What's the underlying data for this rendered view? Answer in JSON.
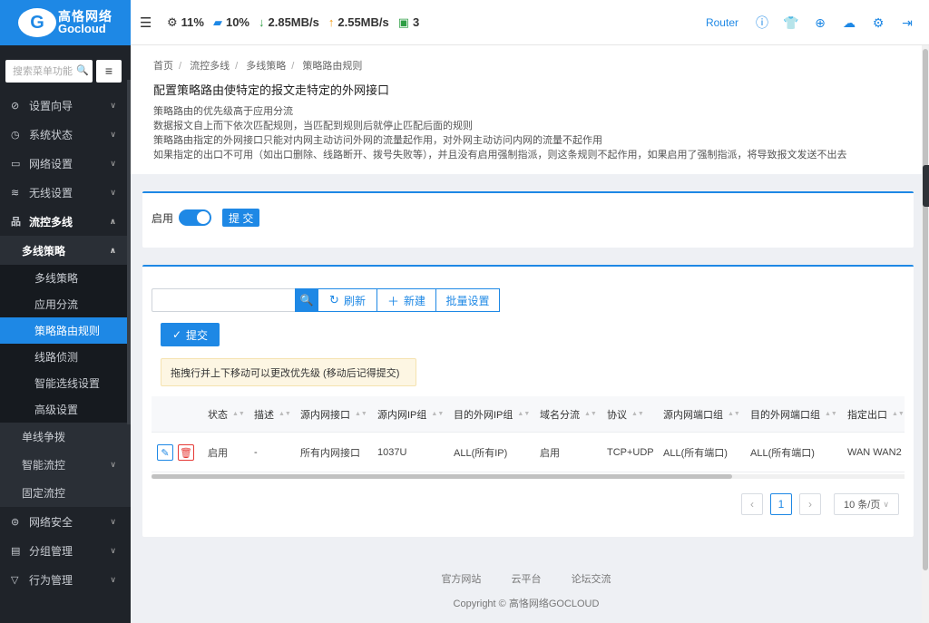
{
  "brand": {
    "logo_mark": "G",
    "name_cn": "高恪网络",
    "name_en": "Gocloud"
  },
  "sidebar": {
    "search_placeholder": "搜索菜单功能",
    "menu_icon": "≡",
    "items": [
      {
        "icon": "⊘",
        "label": "设置向导"
      },
      {
        "icon": "◷",
        "label": "系统状态"
      },
      {
        "icon": "▭",
        "label": "网络设置"
      },
      {
        "icon": "≋",
        "label": "无线设置"
      },
      {
        "icon": "品",
        "label": "流控多线"
      }
    ],
    "sub_open": "多线策略",
    "leaves": [
      "多线策略",
      "应用分流",
      "策略路由规则",
      "线路侦测",
      "智能选线设置",
      "高级设置"
    ],
    "sub_rest": [
      "单线争拨",
      "智能流控",
      "固定流控"
    ],
    "bottom_items": [
      {
        "icon": "⊜",
        "label": "网络安全"
      },
      {
        "icon": "▤",
        "label": "分组管理"
      },
      {
        "icon": "▽",
        "label": "行为管理"
      }
    ]
  },
  "topbar": {
    "collapse_icon": "☰",
    "cpu": "11%",
    "mem": "10%",
    "down": "2.85MB/s",
    "up": "2.55MB/s",
    "devices": "3",
    "router_label": "Router",
    "icons": [
      "info-icon",
      "shirt-icon",
      "globe-icon",
      "cloud-upload-icon",
      "gear-icon",
      "logout-icon"
    ]
  },
  "header": {
    "breadcrumb": [
      "首页",
      "流控多线",
      "多线策略",
      "策略路由规则"
    ],
    "title": "配置策略路由使特定的报文走特定的外网接口",
    "desc": [
      "策略路由的优先级高于应用分流",
      "数据报文自上而下依次匹配规则，当匹配到规则后就停止匹配后面的规则",
      "策略路由指定的外网接口只能对内网主动访问外网的流量起作用，对外网主动访问内网的流量不起作用",
      "如果指定的出口不可用（如出口删除、线路断开、拨号失败等），并且没有启用强制指派，则这条规则不起作用，如果启用了强制指派，将导致报文发送不出去"
    ]
  },
  "enable_card": {
    "label": "启用",
    "enabled": true,
    "submit": "提 交"
  },
  "toolbar": {
    "refresh": "刷新",
    "new": "新建",
    "batch": "批量设置",
    "submit": "提交"
  },
  "tip": "拖拽行并上下移动可以更改优先级 (移动后记得提交)",
  "table": {
    "columns": [
      "状态",
      "描述",
      "源内网接口",
      "源内网IP组",
      "目的外网IP组",
      "域名分流",
      "协议",
      "源内网端口组",
      "目的外网端口组",
      "指定出口"
    ],
    "rows": [
      [
        "启用",
        "-",
        "所有内网接口",
        "1037U",
        "ALL(所有IP)",
        "启用",
        "TCP+UDP",
        "ALL(所有端口)",
        "ALL(所有端口)",
        "WAN WAN2"
      ]
    ]
  },
  "pager": {
    "prev": "‹",
    "current": "1",
    "next": "›",
    "size": "10 条/页"
  },
  "footer": {
    "links": [
      "官方网站",
      "云平台",
      "论坛交流"
    ],
    "copyright": "Copyright © 高恪网络GOCLOUD"
  },
  "colors": {
    "accent": "#1e88e5",
    "sidebar": "#1f2329",
    "danger": "#e53935"
  }
}
